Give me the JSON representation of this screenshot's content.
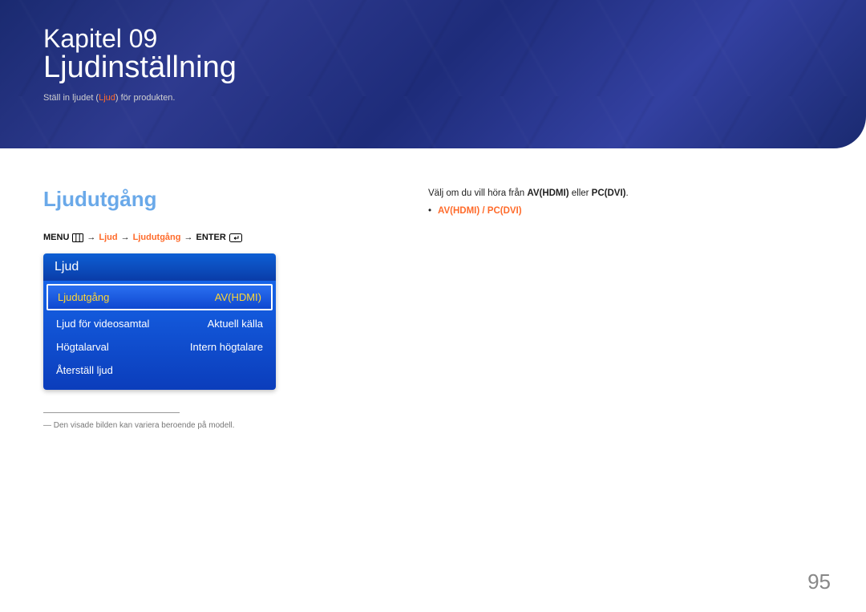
{
  "banner": {
    "chapter_label": "Kapitel 09",
    "chapter_title": "Ljudinställning",
    "caption_pre": "Ställ in ljudet (",
    "caption_accent": "Ljud",
    "caption_post": ") för produkten."
  },
  "left": {
    "section_heading": "Ljudutgång",
    "menu_path": {
      "p1": "MENU",
      "arrow": "→",
      "p2": "Ljud",
      "p3": "Ljudutgång",
      "p4": "ENTER"
    },
    "osd": {
      "header": "Ljud",
      "rows": [
        {
          "label": "Ljudutgång",
          "value": "AV(HDMI)",
          "selected": true
        },
        {
          "label": "Ljud för videosamtal",
          "value": "Aktuell källa",
          "selected": false
        },
        {
          "label": "Högtalarval",
          "value": "Intern högtalare",
          "selected": false
        },
        {
          "label": "Återställ ljud",
          "value": "",
          "selected": false
        }
      ]
    },
    "footnote": "― Den visade bilden kan variera beroende på modell."
  },
  "right": {
    "desc_pre": "Välj om du vill höra från ",
    "desc_opt1": "AV(HDMI)",
    "desc_mid": " eller ",
    "desc_opt2": "PC(DVI)",
    "desc_post": ".",
    "bullet_dot": "•",
    "bullet_text": "AV(HDMI) / PC(DVI)"
  },
  "page_number": "95"
}
